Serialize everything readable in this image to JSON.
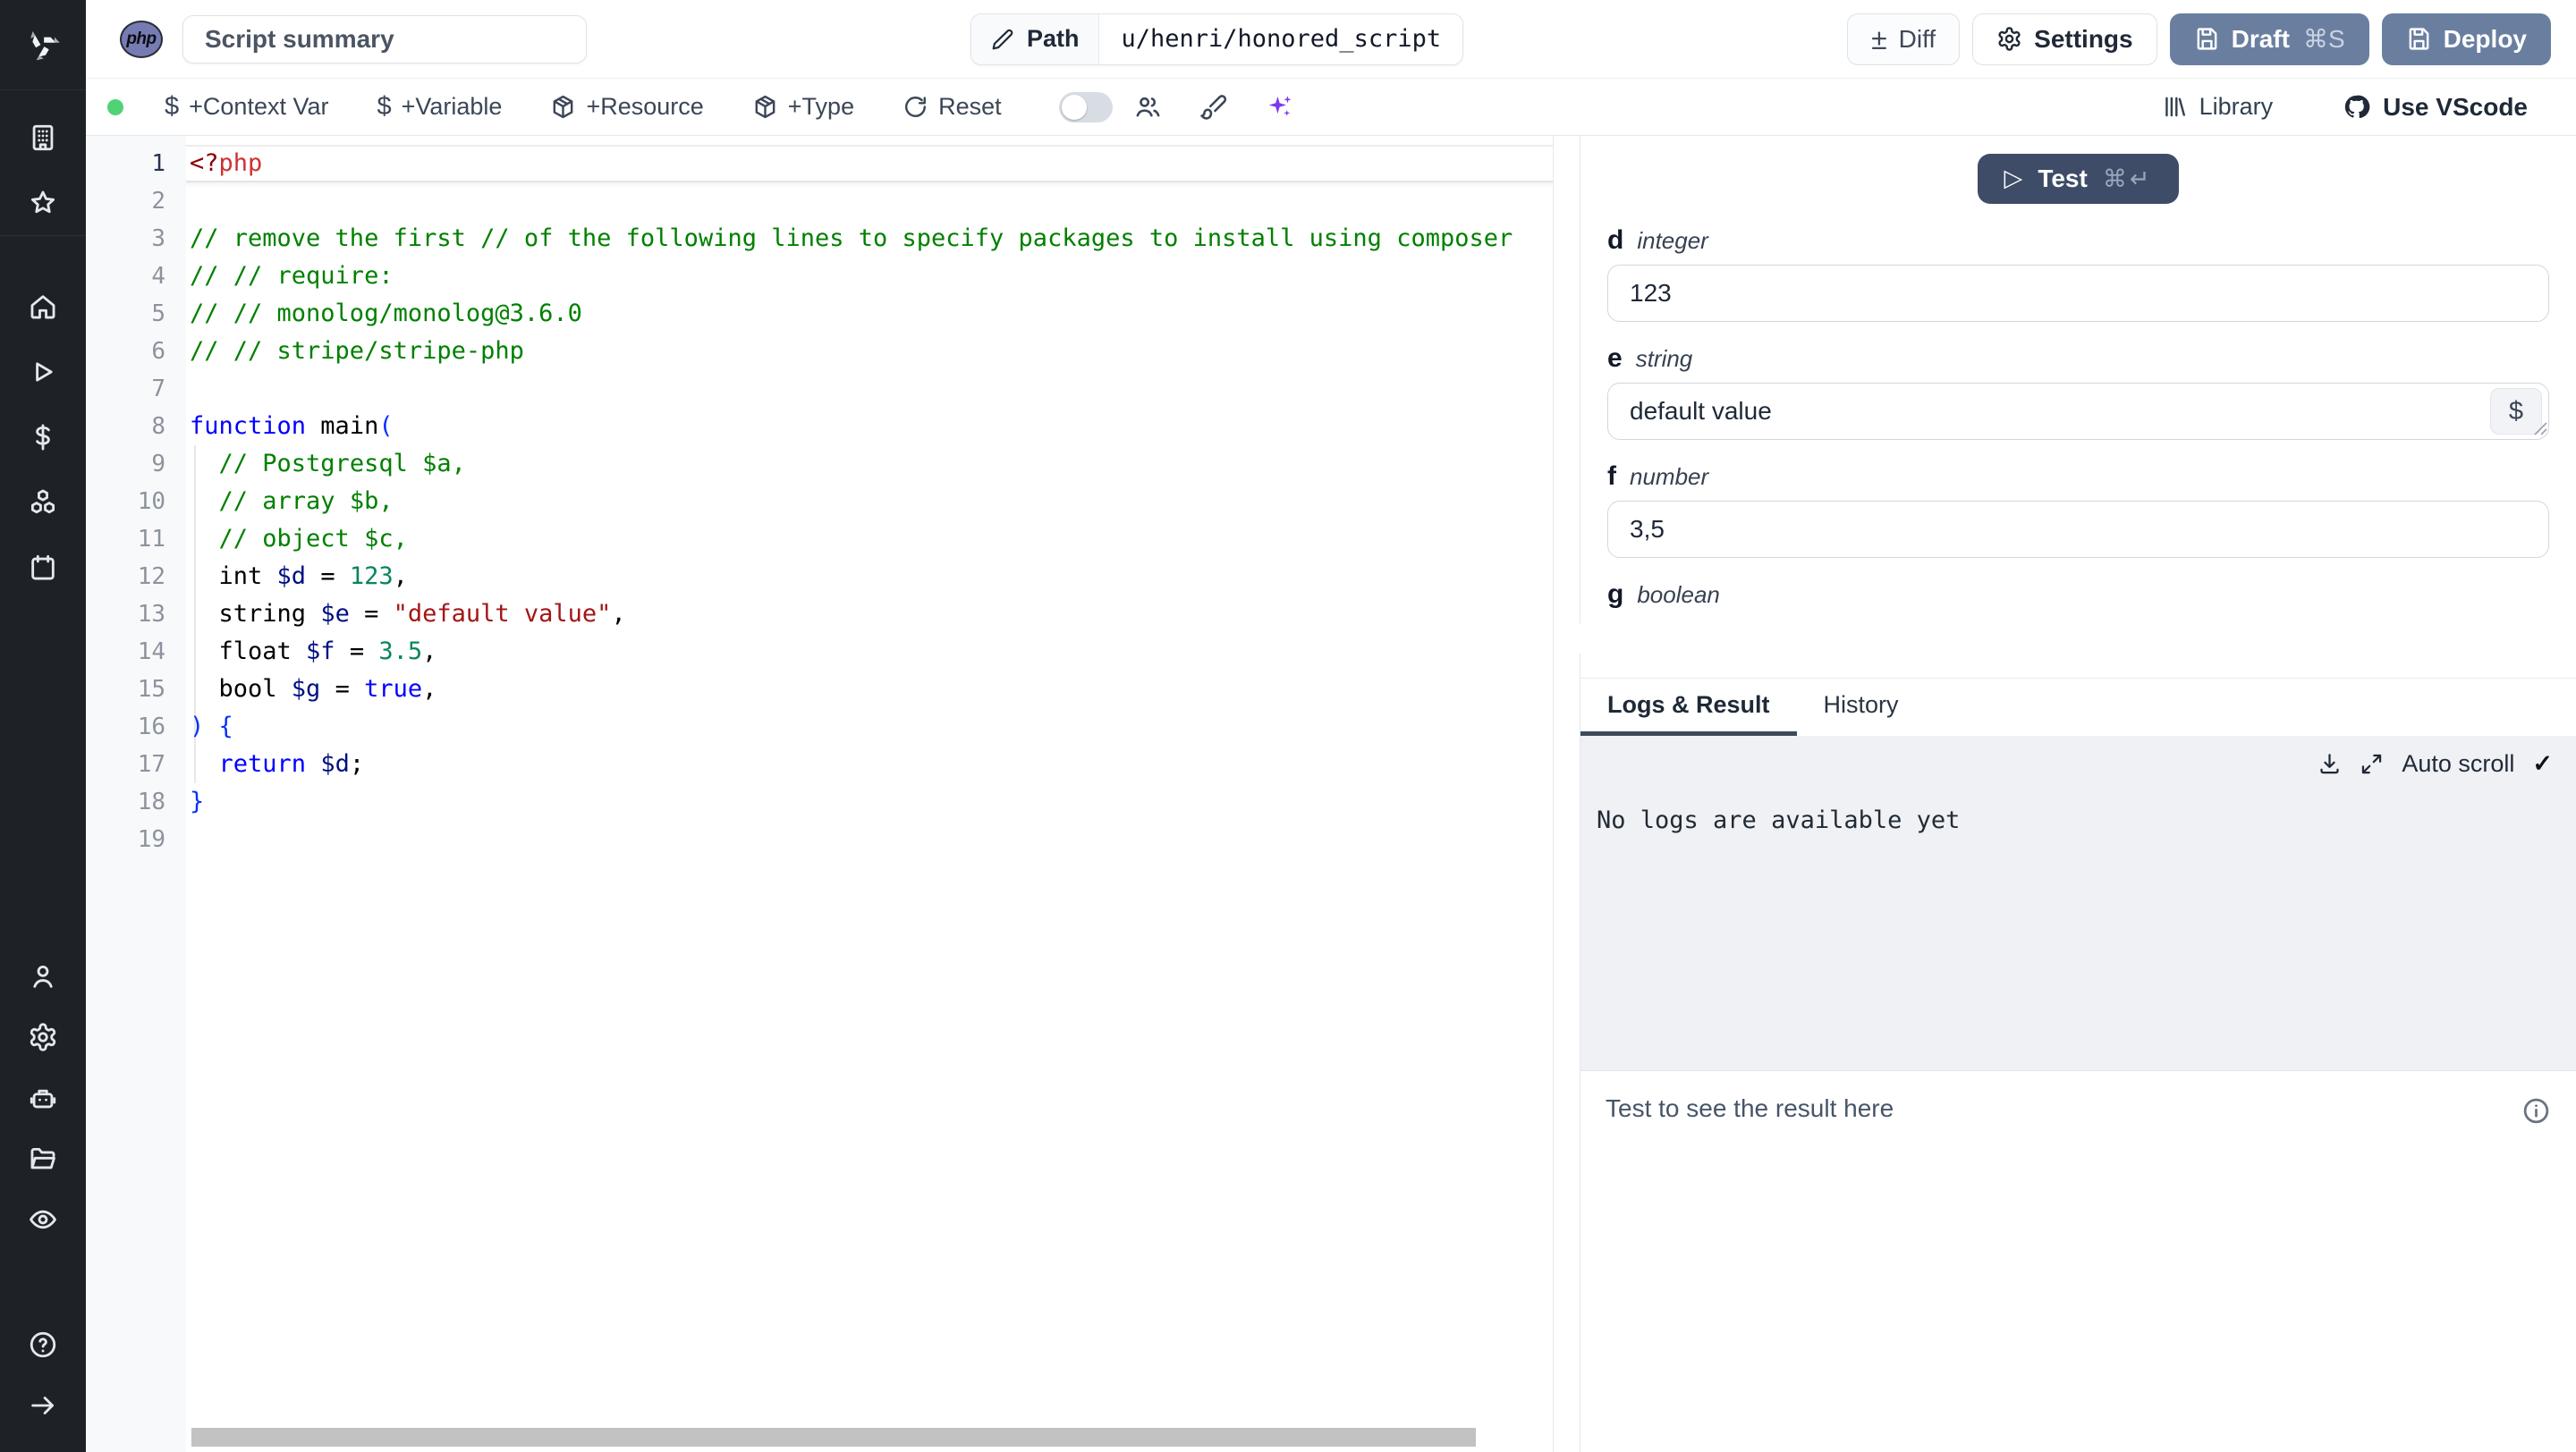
{
  "header": {
    "language_badge": "php",
    "summary_value": "Script summary",
    "path_label": "Path",
    "path_value": "u/henri/honored_script",
    "diff_label": "Diff",
    "settings_label": "Settings",
    "draft_label": "Draft",
    "draft_shortcut": "⌘S",
    "deploy_label": "Deploy"
  },
  "toolbar": {
    "context_var_label": "+Context Var",
    "variable_label": "+Variable",
    "resource_label": "+Resource",
    "type_label": "+Type",
    "reset_label": "Reset",
    "library_label": "Library",
    "vscode_label": "Use VScode",
    "icons": [
      "status-dot-green",
      "dollar",
      "dollar",
      "package",
      "package",
      "rotate-cw",
      "toggle-off",
      "users",
      "paintbrush",
      "ai-sparkles",
      "library-shelf",
      "github"
    ]
  },
  "sidebar": {
    "icons": [
      "windmill-logo",
      "workspace-building",
      "favorites-star",
      "home",
      "runs-play",
      "variables-dollar",
      "resources-cubes",
      "schedules-calendar",
      "user",
      "settings-gear",
      "workers-robot",
      "folders",
      "audit-eye",
      "help-circle",
      "expand-arrow"
    ]
  },
  "editor": {
    "active_line": 1,
    "line_count": 19,
    "lines": [
      [
        {
          "t": "<?",
          "c": "phpo"
        },
        {
          "t": "php",
          "c": "phpn"
        }
      ],
      [],
      [
        {
          "t": "// remove the first // of the following lines to specify packages to install using composer",
          "c": "comment"
        }
      ],
      [
        {
          "t": "// // require:",
          "c": "comment"
        }
      ],
      [
        {
          "t": "// // monolog/monolog@3.6.0",
          "c": "comment"
        }
      ],
      [
        {
          "t": "// // stripe/stripe-php",
          "c": "comment"
        }
      ],
      [],
      [
        {
          "t": "function",
          "c": "kw"
        },
        {
          "t": " main",
          "c": "plain"
        },
        {
          "t": "(",
          "c": "bracket"
        }
      ],
      [
        {
          "t": "  ",
          "c": "plain"
        },
        {
          "t": "// Postgresql $a,",
          "c": "comment"
        }
      ],
      [
        {
          "t": "  ",
          "c": "plain"
        },
        {
          "t": "// array $b,",
          "c": "comment"
        }
      ],
      [
        {
          "t": "  ",
          "c": "plain"
        },
        {
          "t": "// object $c,",
          "c": "comment"
        }
      ],
      [
        {
          "t": "  int ",
          "c": "plain"
        },
        {
          "t": "$d",
          "c": "var"
        },
        {
          "t": " = ",
          "c": "plain"
        },
        {
          "t": "123",
          "c": "num"
        },
        {
          "t": ",",
          "c": "plain"
        }
      ],
      [
        {
          "t": "  string ",
          "c": "plain"
        },
        {
          "t": "$e",
          "c": "var"
        },
        {
          "t": " = ",
          "c": "plain"
        },
        {
          "t": "\"default value\"",
          "c": "str"
        },
        {
          "t": ",",
          "c": "plain"
        }
      ],
      [
        {
          "t": "  float ",
          "c": "plain"
        },
        {
          "t": "$f",
          "c": "var"
        },
        {
          "t": " = ",
          "c": "plain"
        },
        {
          "t": "3.5",
          "c": "num"
        },
        {
          "t": ",",
          "c": "plain"
        }
      ],
      [
        {
          "t": "  bool ",
          "c": "plain"
        },
        {
          "t": "$g",
          "c": "var"
        },
        {
          "t": " = ",
          "c": "plain"
        },
        {
          "t": "true",
          "c": "kw"
        },
        {
          "t": ",",
          "c": "plain"
        }
      ],
      [
        {
          "t": ") {",
          "c": "bracket"
        }
      ],
      [
        {
          "t": "  ",
          "c": "plain"
        },
        {
          "t": "return",
          "c": "kw"
        },
        {
          "t": " ",
          "c": "plain"
        },
        {
          "t": "$d",
          "c": "var"
        },
        {
          "t": ";",
          "c": "plain"
        }
      ],
      [
        {
          "t": "}",
          "c": "bracket"
        }
      ],
      []
    ],
    "syntax_colors": {
      "comment": "#008000",
      "keyword": "#0000ff",
      "variable": "#001080",
      "number": "#098658",
      "string": "#a31515",
      "bracket": "#0431fa",
      "php_open_tag": "#8b0000",
      "php_tag_name": "#cd3131"
    }
  },
  "right_panel": {
    "test_button": {
      "label": "Test",
      "shortcut": "⌘↵"
    },
    "fields": [
      {
        "name": "d",
        "type": "integer",
        "value": "123"
      },
      {
        "name": "e",
        "type": "string",
        "value": "default value"
      },
      {
        "name": "f",
        "type": "number",
        "value": "3,5"
      },
      {
        "name": "g",
        "type": "boolean",
        "value": "on"
      }
    ],
    "string_field_dollar_label": "$",
    "tabs": [
      "Logs & Result",
      "History"
    ],
    "active_tab": "Logs & Result",
    "auto_scroll_label": "Auto scroll",
    "logs_empty_text": "No logs are available yet",
    "result_placeholder": "Test to see the result here"
  },
  "colors": {
    "sidebar_bg": "#1e2126",
    "deploy_button": "#6a7fa0",
    "test_button": "#3e4c68",
    "toggle_on_blue": "#3b6cf0",
    "status_dot_green": "#4fd376",
    "ai_purple": "#7c3aed",
    "php_badge_purple": "#777bb4",
    "active_tab_underline": "#3d4a5c",
    "logs_bg": "#f0f1f4"
  }
}
